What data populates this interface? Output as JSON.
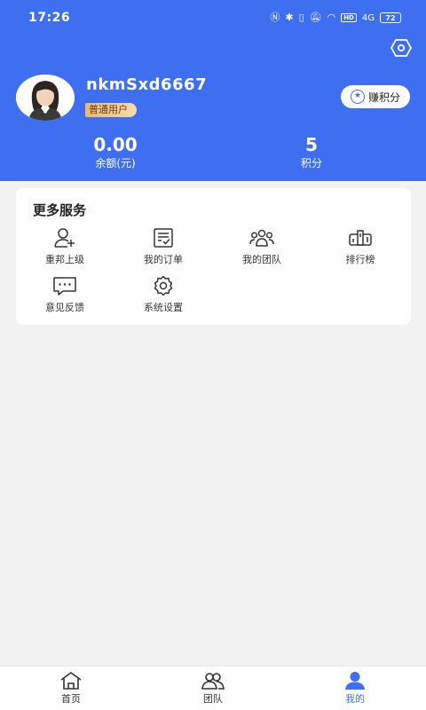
{
  "statusbar": {
    "time": "17:26",
    "battery": "72",
    "network": "4G",
    "hd": "HD"
  },
  "header": {
    "settings_icon": "settings-icon",
    "username": "nkmSxd6667",
    "user_tag": "普通用户",
    "earn_button": "赚积分",
    "stats": {
      "balance_value": "0.00",
      "balance_label": "余额(元)",
      "points_value": "5",
      "points_label": "积分"
    },
    "colors": {
      "primary": "#3d6ff0",
      "tag": "#e8b878"
    }
  },
  "services": {
    "title": "更多服务",
    "items": [
      {
        "label": "重邦上级",
        "icon": "add-user-icon"
      },
      {
        "label": "我的订单",
        "icon": "order-icon"
      },
      {
        "label": "我的团队",
        "icon": "team-icon"
      },
      {
        "label": "排行榜",
        "icon": "ranking-icon"
      },
      {
        "label": "意见反馈",
        "icon": "feedback-icon"
      },
      {
        "label": "系统设置",
        "icon": "gear-icon"
      }
    ]
  },
  "tabbar": {
    "tabs": [
      {
        "label": "首页",
        "icon": "home-icon"
      },
      {
        "label": "团队",
        "icon": "team-icon"
      },
      {
        "label": "我的",
        "icon": "profile-icon",
        "active": true
      }
    ]
  }
}
